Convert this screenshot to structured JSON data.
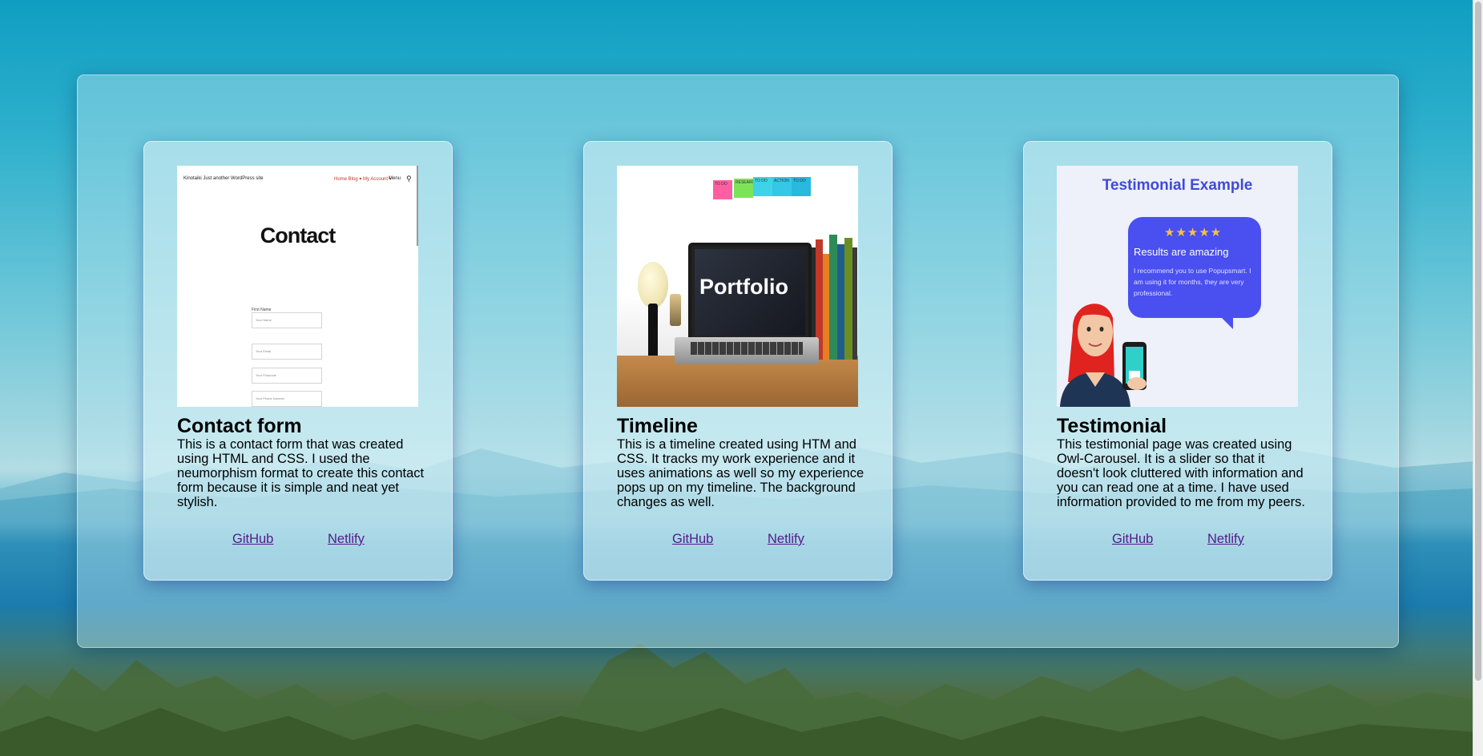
{
  "projects": [
    {
      "title": "Contact form",
      "description": "This is a contact form that was created using HTML and CSS. I used the neumorphism format to create this contact form because it is simple and neat yet stylish.",
      "links": [
        "GitHub",
        "Netlify"
      ],
      "thumbnail": {
        "heading": "Contact",
        "logo": "Kinotaiki Just another WordPress site",
        "nav": "Home  Blog ▾  My Account ▾",
        "menu": "Menu",
        "field_label": "First Name",
        "fields": [
          "Your Name",
          "Your Email",
          "Your Postcode",
          "Your Phone Number"
        ]
      }
    },
    {
      "title": "Timeline",
      "description": "This is a timeline created using HTM and CSS. It tracks my work experience and it uses animations as well so my experience pops up on my timeline. The background changes as well.",
      "links": [
        "GitHub",
        "Netlify"
      ],
      "thumbnail": {
        "screen_text": "Portfolio",
        "notes": [
          "TO DO",
          "RESEARCH",
          "TO DO",
          "ACTION",
          "TO DO"
        ]
      }
    },
    {
      "title": "Testimonial",
      "description": "This testimonial page was created using Owl-Carousel. It is a slider so that it doesn't look cluttered with information and you can read one at a time. I have used information provided to me from my peers.",
      "links": [
        "GitHub",
        "Netlify"
      ],
      "thumbnail": {
        "title": "Testimonial Example",
        "stars": "★★★★★",
        "bubble_heading": "Results are amazing",
        "bubble_body": "I recommend you to use Popupsmart. I am using it for months, they are very professional."
      }
    }
  ],
  "colors": {
    "link": "#551a8b",
    "testimonial_accent": "#4a4ff0",
    "testimonial_title": "#3f4bd8"
  }
}
